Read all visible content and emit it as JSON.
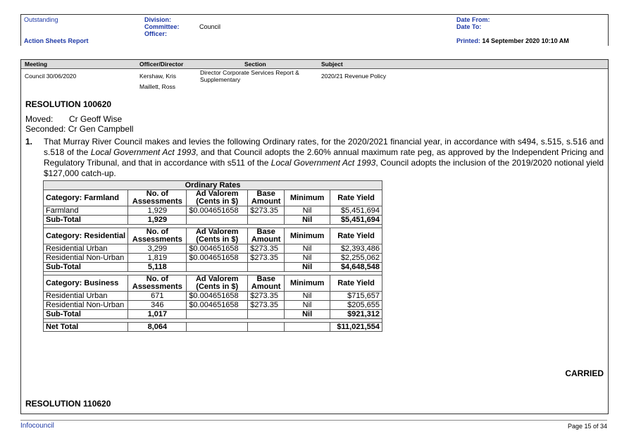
{
  "header": {
    "outstanding": "Outstanding",
    "report_name": "Action Sheets Report",
    "division_label": "Division:",
    "committee_label": "Committee:",
    "committee_value": "Council",
    "officer_label": "Officer:",
    "date_from_label": "Date From:",
    "date_to_label": "Date To:",
    "printed_label": "Printed:",
    "printed_value": "14 September 2020 10:10 AM"
  },
  "columns": {
    "meeting": "Meeting",
    "officer": "Officer/Director",
    "section": "Section",
    "subject": "Subject"
  },
  "item": {
    "meeting": "Council 30/06/2020",
    "officer1": "Kershaw, Kris",
    "officer2": "Maillett, Ross",
    "section": "Director Corporate Services Report & Supplementary",
    "subject": "2020/21 Revenue Policy"
  },
  "resolution": {
    "number": "RESOLUTION 100620",
    "moved_label": "Moved:",
    "moved_value": "Cr Geoff Wise",
    "seconded_label": "Seconded:",
    "seconded_value": "Cr Gen Campbell",
    "para_num": "1.",
    "para_part1": "That Murray River Council makes and levies the following Ordinary rates, for the 2020/2021 financial year, in accordance with s494, s.515, s.516 and s.518 of the ",
    "para_italic1": "Local Government Act 1993",
    "para_part2": ", and that Council adopts the 2.60% annual maximum rate peg, as approved by the Independent Pricing and Regulatory Tribunal, and that in accordance with s511 of the ",
    "para_italic2": "Local Government Act 1993",
    "para_part3": ", Council adopts the inclusion of the 2019/2020 notional yield $127,000 catch-up.",
    "carried": "CARRIED",
    "next_number": "RESOLUTION 110620"
  },
  "table": {
    "title": "Ordinary Rates",
    "h_assess": "No. of Assessments",
    "h_advalorem": "Ad Valorem (Cents in $)",
    "h_base": "Base Amount",
    "h_min": "Minimum",
    "h_yield": "Rate Yield",
    "farm": {
      "cat": "Category: Farmland",
      "rows": [
        {
          "name": "Farmland",
          "n": "1,929",
          "av": "$0.004651658",
          "base": "$273.35",
          "min": "Nil",
          "yield": "$5,451,694"
        }
      ],
      "sub": {
        "name": "Sub-Total",
        "n": "1,929",
        "min": "Nil",
        "yield": "$5,451,694"
      }
    },
    "res": {
      "cat": "Category: Residential",
      "rows": [
        {
          "name": "Residential Urban",
          "n": "3,299",
          "av": "$0.004651658",
          "base": "$273.35",
          "min": "Nil",
          "yield": "$2,393,486"
        },
        {
          "name": "Residential Non-Urban",
          "n": "1,819",
          "av": "$0.004651658",
          "base": "$273.35",
          "min": "Nil",
          "yield": "$2,255,062"
        }
      ],
      "sub": {
        "name": "Sub-Total",
        "n": "5,118",
        "min": "Nil",
        "yield": "$4,648,548"
      }
    },
    "bus": {
      "cat": "Category: Business",
      "rows": [
        {
          "name": "Residential Urban",
          "n": "671",
          "av": "$0.004651658",
          "base": "$273.35",
          "min": "Nil",
          "yield": "$715,657"
        },
        {
          "name": "Residential Non-Urban",
          "n": "346",
          "av": "$0.004651658",
          "base": "$273.35",
          "min": "Nil",
          "yield": "$205,655"
        }
      ],
      "sub": {
        "name": "Sub-Total",
        "n": "1,017",
        "min": "Nil",
        "yield": "$921,312"
      }
    },
    "net": {
      "name": "Net Total",
      "n": "8,064",
      "yield": "$11,021,554"
    }
  },
  "footer": {
    "brand": "Infocouncil",
    "page": "Page 15 of 34"
  }
}
